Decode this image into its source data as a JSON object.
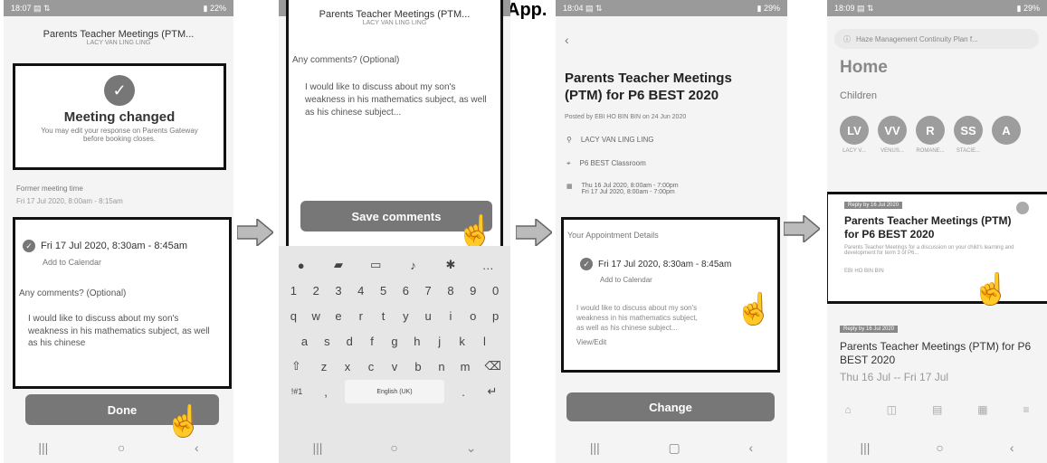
{
  "caption": "App.",
  "s1": {
    "title": "Parents Teacher Meetings (PTM...",
    "subtitle": "LACY VAN LING LING",
    "changed_title": "Meeting changed",
    "changed_desc": "You may edit your response on Parents Gateway before booking closes.",
    "former_label": "Former meeting time",
    "former_value": "Fri 17 Jul 2020, 8:00am - 8:15am",
    "slot": "Fri 17 Jul 2020, 8:30am - 8:45am",
    "add_calendar": "Add to Calendar",
    "comments_label": "Any comments? (Optional)",
    "comment": "I would like to discuss about my son's weakness in his mathematics subject, as well as his chinese",
    "done": "Done"
  },
  "s2": {
    "title": "Parents Teacher Meetings (PTM...",
    "subtitle": "LACY VAN LING LING",
    "comments_label": "Any comments? (Optional)",
    "comment": "I would like to discuss about my son's weakness in his mathematics subject, as well as his chinese subject...",
    "save": "Save comments",
    "numbers": [
      "1",
      "2",
      "3",
      "4",
      "5",
      "6",
      "7",
      "8",
      "9",
      "0"
    ],
    "row1": [
      "q",
      "w",
      "e",
      "r",
      "t",
      "y",
      "u",
      "i",
      "o",
      "p"
    ],
    "row2": [
      "a",
      "s",
      "d",
      "f",
      "g",
      "h",
      "j",
      "k",
      "l"
    ],
    "row3": [
      "z",
      "x",
      "c",
      "v",
      "b",
      "n",
      "m"
    ],
    "sym": "!#1",
    "space": "English (UK)"
  },
  "s3": {
    "title": "Parents Teacher Meetings (PTM) for P6 BEST 2020",
    "posted": "Posted by EBI HO BIN BIN on 24 Jun 2020",
    "student": "LACY VAN LING LING",
    "venue": "P6 BEST Classroom",
    "dates1": "Thu 16 Jul 2020, 8:00am - 7:00pm",
    "dates2": "Fri 17 Jul 2020, 8:00am - 7:00pm",
    "appt_label": "Your Appointment Details",
    "slot": "Fri 17 Jul 2020, 8:30am - 8:45am",
    "add_calendar": "Add to Calendar",
    "comment": "I would like to discuss about my son's weakness in his mathematics subject, as well as his chinese subject...",
    "view_edit": "View/Edit",
    "change": "Change"
  },
  "s4": {
    "banner": "Haze Management Continuity Plan f...",
    "home": "Home",
    "children": "Children",
    "avatars": [
      "LV",
      "VV",
      "R",
      "SS"
    ],
    "avatar_names": [
      "LACY V...",
      "VENUS...",
      "ROMANE...",
      "STACIE..."
    ],
    "card1_tag": "Reply by 16 Jul 2020",
    "card1_title": "Parents Teacher Meetings (PTM) for P6 BEST 2020",
    "card1_desc": "Parents Teacher Meetings for a discussion on your child's learning and development for term 3 of P6...",
    "card1_from": "EBI HO BIN BIN",
    "card2_tag": "Reply by 16 Jul 2020",
    "card2_title": "Parents Teacher Meetings (PTM) for P6 BEST 2020",
    "card2_dates": "Thu 16 Jul -- Fri 17 Jul"
  }
}
